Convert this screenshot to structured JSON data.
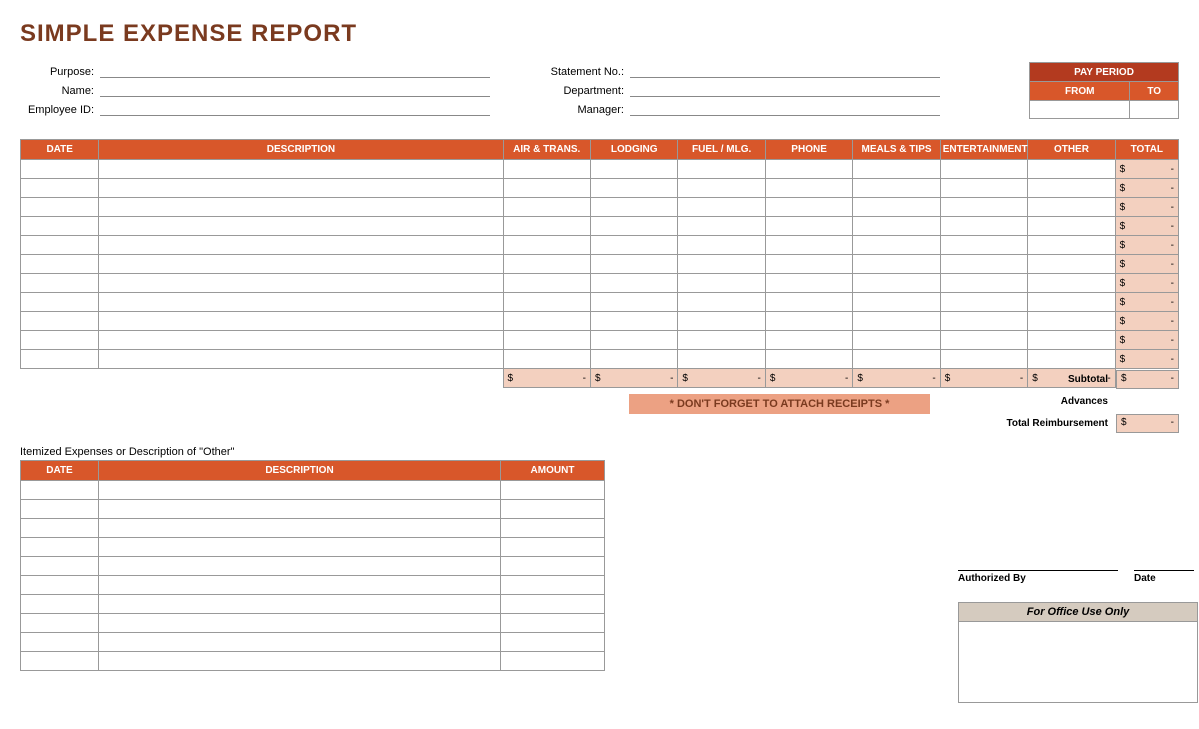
{
  "title": "SIMPLE EXPENSE REPORT",
  "fields_left": [
    {
      "label": "Purpose:"
    },
    {
      "label": "Name:"
    },
    {
      "label": "Employee ID:"
    }
  ],
  "fields_right": [
    {
      "label": "Statement No.:"
    },
    {
      "label": "Department:"
    },
    {
      "label": "Manager:"
    }
  ],
  "pay_period": {
    "title": "PAY PERIOD",
    "from": "FROM",
    "to": "TO"
  },
  "columns": {
    "date": "DATE",
    "description": "DESCRIPTION",
    "air_trans": "AIR & TRANS.",
    "lodging": "LODGING",
    "fuel_mlg": "FUEL / MLG.",
    "phone": "PHONE",
    "meals_tips": "MEALS & TIPS",
    "entertainment": "ENTERTAINMENT",
    "other": "OTHER",
    "total": "TOTAL"
  },
  "main_rows": 11,
  "row_total": {
    "symbol": "$",
    "value": "-"
  },
  "column_totals": [
    {
      "symbol": "$",
      "value": "-"
    },
    {
      "symbol": "$",
      "value": "-"
    },
    {
      "symbol": "$",
      "value": "-"
    },
    {
      "symbol": "$",
      "value": "-"
    },
    {
      "symbol": "$",
      "value": "-"
    },
    {
      "symbol": "$",
      "value": "-"
    },
    {
      "symbol": "$",
      "value": "-"
    }
  ],
  "notice": "* DON'T FORGET TO ATTACH RECEIPTS *",
  "summary": {
    "subtotal": {
      "label": "Subtotal",
      "symbol": "$",
      "value": "-"
    },
    "advances": {
      "label": "Advances"
    },
    "total_reimb": {
      "label": "Total Reimbursement",
      "symbol": "$",
      "value": "-"
    }
  },
  "itemized_label": "Itemized Expenses or Description of \"Other\"",
  "itemized_columns": {
    "date": "DATE",
    "description": "DESCRIPTION",
    "amount": "AMOUNT"
  },
  "itemized_rows": 10,
  "signature": {
    "authorized": "Authorized By",
    "date": "Date"
  },
  "office": {
    "title": "For Office Use Only"
  }
}
